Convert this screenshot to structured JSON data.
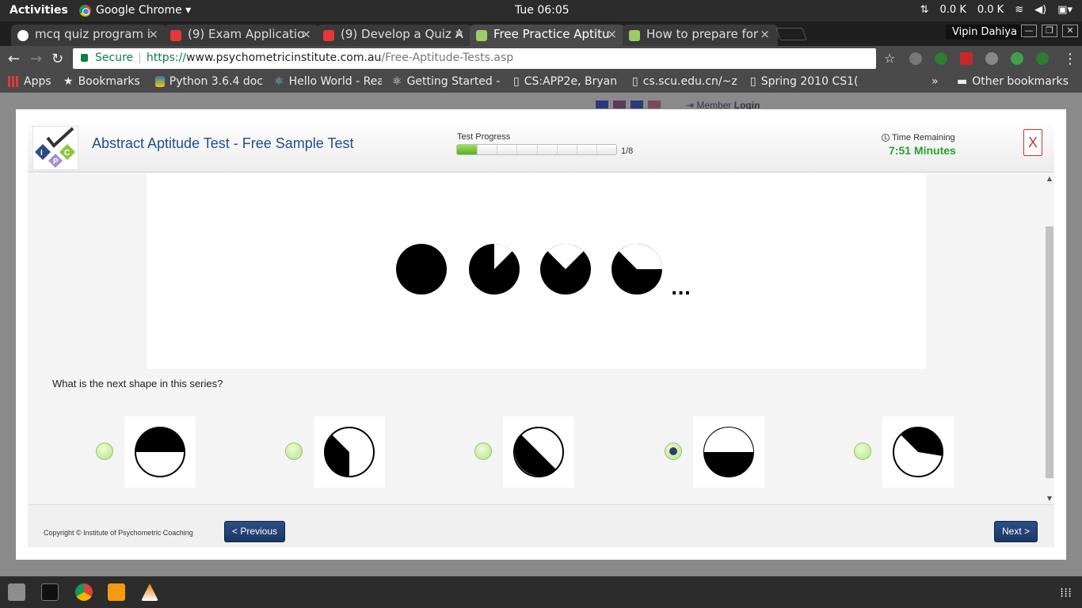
{
  "system": {
    "activities": "Activities",
    "app_name": "Google Chrome ▾",
    "clock": "Tue 06:05",
    "net_up": "0.0 K",
    "net_down": "0.0 K"
  },
  "browser": {
    "tabs": [
      {
        "label": "mcq quiz program i",
        "active": false
      },
      {
        "label": "(9) Exam Applicatio",
        "active": false
      },
      {
        "label": "(9) Develop a Quiz A",
        "active": false
      },
      {
        "label": "Free Practice Aptitu",
        "active": true
      },
      {
        "label": "How to prepare for",
        "active": false
      }
    ],
    "profile": "Vipin Dahiya",
    "address": {
      "secure_label": "Secure",
      "protocol": "https://",
      "host": "www.psychometricinstitute.com.au",
      "path": "/Free-Aptitude-Tests.asp"
    },
    "bookmarks": [
      {
        "label": "Apps"
      },
      {
        "label": "Bookmarks"
      },
      {
        "label": "Python 3.6.4 doc"
      },
      {
        "label": "Hello World - Rea"
      },
      {
        "label": "Getting Started -"
      },
      {
        "label": "CS:APP2e, Bryan"
      },
      {
        "label": "cs.scu.edu.cn/~z"
      },
      {
        "label": "Spring 2010 CS1("
      }
    ],
    "bookmarks_overflow": "»",
    "other_bookmarks": "Other bookmarks"
  },
  "background_page": {
    "member_login_prefix": "Member",
    "member_login": "Login"
  },
  "test": {
    "title": "Abstract Aptitude Test - Free Sample Test",
    "progress_label": "Test Progress",
    "progress_current": 1,
    "progress_total": 8,
    "progress_count": "1/8",
    "time_label": "Time Remaining",
    "time_value": "7:51 Minutes",
    "close_label": "X",
    "question": "What is the next shape in this series?",
    "series_ellipsis": "...",
    "selected_option": 4,
    "copyright": "Copyright © Institute of Psychometric Coaching",
    "previous_label": "< Previous",
    "next_label": "Next >"
  },
  "colors": {
    "title_blue": "#1f4e8c",
    "timer_green": "#2e9e2e",
    "close_red": "#c0392b",
    "button_navy": "#1b3766",
    "progress_green": "#57ae20"
  }
}
